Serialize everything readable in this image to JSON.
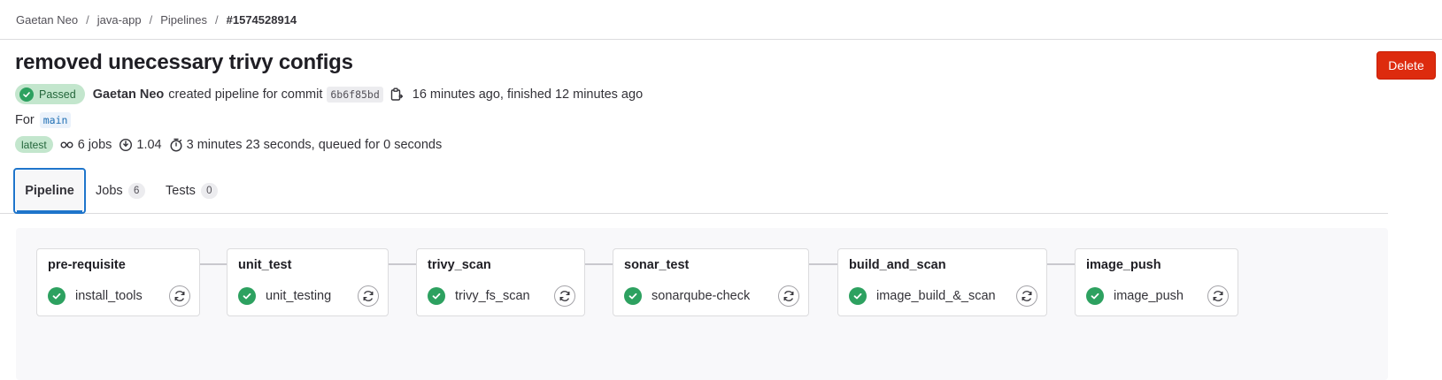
{
  "breadcrumb": [
    "Gaetan Neo",
    "java-app",
    "Pipelines",
    "#1574528914"
  ],
  "pipeline": {
    "title": "removed unecessary trivy configs",
    "delete_label": "Delete",
    "status": "Passed",
    "author": "Gaetan Neo",
    "action_text": "created pipeline for commit",
    "commit_sha": "6b6f85bd",
    "timing": "16 minutes ago, finished 12 minutes ago",
    "for_label": "For",
    "ref": "main",
    "latest_badge": "latest",
    "jobs_count": "6 jobs",
    "coverage": "1.04",
    "duration": "3 minutes 23 seconds, queued for 0 seconds"
  },
  "tabs": [
    {
      "label": "Pipeline",
      "count": null
    },
    {
      "label": "Jobs",
      "count": "6"
    },
    {
      "label": "Tests",
      "count": "0"
    }
  ],
  "stages": [
    {
      "name": "pre-requisite",
      "job": "install_tools",
      "status": "passed"
    },
    {
      "name": "unit_test",
      "job": "unit_testing",
      "status": "passed"
    },
    {
      "name": "trivy_scan",
      "job": "trivy_fs_scan",
      "status": "passed"
    },
    {
      "name": "sonar_test",
      "job": "sonarqube-check",
      "status": "passed"
    },
    {
      "name": "build_and_scan",
      "job": "image_build_&_scan",
      "status": "passed"
    },
    {
      "name": "image_push",
      "job": "image_push",
      "status": "passed"
    }
  ],
  "colors": {
    "success": "#2da160",
    "delete": "#dd2b0e",
    "active_tab_border": "#1f75cb"
  },
  "icons": {
    "status": "check-circle-icon",
    "copy": "copy-icon",
    "jobs": "pipeline-icon",
    "coverage": "coverage-icon",
    "duration": "timer-icon",
    "retry": "retry-icon"
  }
}
